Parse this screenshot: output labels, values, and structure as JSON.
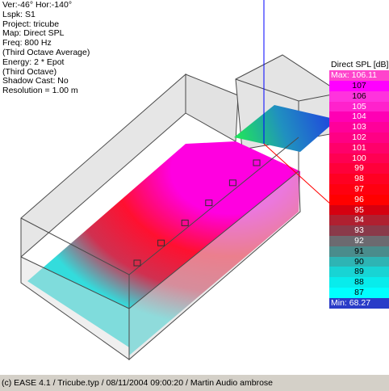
{
  "viewer": {
    "info_lines": [
      "Ver:-46°   Hor:-140°",
      "Lspk: S1",
      "Project: tricube",
      "Map: Direct SPL",
      "Freq: 800 Hz",
      "(Third Octave Average)",
      "Energy: 2 * Epot",
      "(Third Octave)",
      "Shadow Cast: No",
      "Resolution =   1.00 m"
    ]
  },
  "legend": {
    "title": "Direct SPL [dB]",
    "max_label": "Max: 106.11",
    "min_label": "Min:  68.27",
    "max_color": "#ff44cc",
    "min_color": "#2a3cc8",
    "items": [
      {
        "value": "107",
        "color": "#ff00ff",
        "text_color": "#000000"
      },
      {
        "value": "106",
        "color": "#ff33dd",
        "text_color": "#000000"
      },
      {
        "value": "105",
        "color": "#ff22cc",
        "text_color": "#ffffff"
      },
      {
        "value": "104",
        "color": "#ff00b4",
        "text_color": "#ffffff"
      },
      {
        "value": "103",
        "color": "#ff009a",
        "text_color": "#ffffff"
      },
      {
        "value": "102",
        "color": "#ff0084",
        "text_color": "#ffffff"
      },
      {
        "value": "101",
        "color": "#ff006a",
        "text_color": "#ffffff"
      },
      {
        "value": "100",
        "color": "#ff0052",
        "text_color": "#ffffff"
      },
      {
        "value": "99",
        "color": "#ff003a",
        "text_color": "#ffffff"
      },
      {
        "value": "98",
        "color": "#ff0022",
        "text_color": "#ffffff"
      },
      {
        "value": "97",
        "color": "#ff0010",
        "text_color": "#ffffff"
      },
      {
        "value": "96",
        "color": "#ff0000",
        "text_color": "#ffffff"
      },
      {
        "value": "95",
        "color": "#d60010",
        "text_color": "#ffffff"
      },
      {
        "value": "94",
        "color": "#b02030",
        "text_color": "#ffffff"
      },
      {
        "value": "93",
        "color": "#8a3a4a",
        "text_color": "#ffffff"
      },
      {
        "value": "92",
        "color": "#6c6a70",
        "text_color": "#ffffff"
      },
      {
        "value": "91",
        "color": "#4a8c8c",
        "text_color": "#000000"
      },
      {
        "value": "90",
        "color": "#2eb4b4",
        "text_color": "#000000"
      },
      {
        "value": "89",
        "color": "#18d4d4",
        "text_color": "#000000"
      },
      {
        "value": "88",
        "color": "#08ecec",
        "text_color": "#000000"
      },
      {
        "value": "87",
        "color": "#00ffff",
        "text_color": "#000000"
      }
    ]
  },
  "statusbar": {
    "text": "(c) EASE 4.1  / Tricube.typ  / 08/11/2004 09:00:20 / Martin Audio ambrose"
  },
  "colors": {
    "wall_fill": "#d8d8d8",
    "edge": "#4a4a4a",
    "axis_blue": "#0000ff",
    "axis_red": "#ff0000",
    "floor_cyan": "#33dcdc",
    "floor_red": "#ff1030",
    "floor_magenta": "#ff00e0",
    "stage_blue": "#2040e0",
    "stage_green": "#20e060"
  },
  "speaker_count": 6
}
